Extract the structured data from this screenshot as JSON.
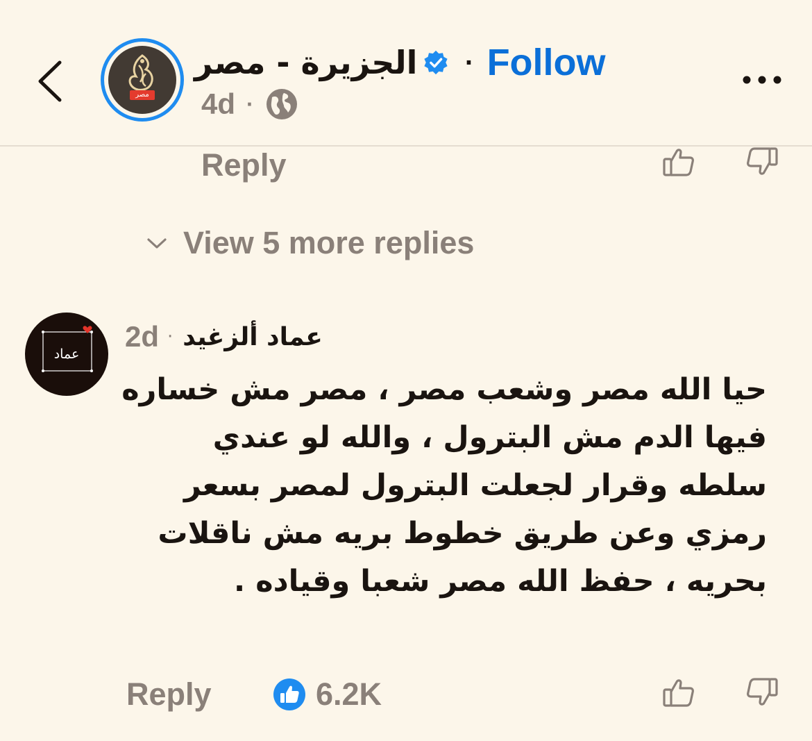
{
  "header": {
    "page_name": "الجزيرة  - مصر",
    "avatar_badge": "مصر",
    "follow_label": "Follow",
    "time": "4d",
    "separator": "·",
    "visibility_icon": "globe-icon",
    "verified_color": "#1f8cf0",
    "follow_color": "#0b6fd8"
  },
  "previous_comment_actions": {
    "reply_label": "Reply"
  },
  "view_more": {
    "label": "View 5 more replies"
  },
  "comment": {
    "author": "عماد ألزغيد",
    "avatar_text": "عماد",
    "time": "2d",
    "separator": "·",
    "body": "حيا الله مصر وشعب مصر ، مصر مش خساره فيها الدم مش البترول ، والله لو عندي سلطه وقرار لجعلت البترول لمصر بسعر رمزي وعن طريق خطوط بريه مش ناقلات بحريه ، حفظ الله مصر شعبا وقياده .",
    "reply_label": "Reply",
    "like_count": "6.2K",
    "like_color": "#1f8cf0"
  },
  "colors": {
    "background": "#fcf6ea",
    "muted_text": "#8a8079",
    "primary_text": "#1a1410"
  }
}
